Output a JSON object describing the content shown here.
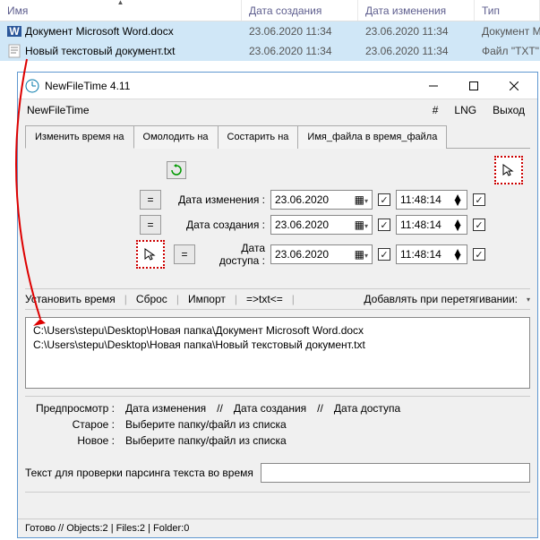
{
  "explorer": {
    "columns": {
      "name": "Имя",
      "created": "Дата создания",
      "modified": "Дата изменения",
      "type": "Тип"
    },
    "rows": [
      {
        "name": "Документ Microsoft Word.docx",
        "created": "23.06.2020 11:34",
        "modified": "23.06.2020 11:34",
        "type": "Документ Micros",
        "icon": "word"
      },
      {
        "name": "Новый текстовый документ.txt",
        "created": "23.06.2020 11:34",
        "modified": "23.06.2020 11:34",
        "type": "Файл \"TXT\"",
        "icon": "txt"
      }
    ]
  },
  "window": {
    "title": "NewFileTime 4.11",
    "brand": "NewFileTime",
    "menu": {
      "hash": "#",
      "lng": "LNG",
      "exit": "Выход"
    }
  },
  "tabs": {
    "set": "Изменить время на",
    "younger": "Омолодить на",
    "older": "Состарить на",
    "filename": "Имя_файла в время_файла"
  },
  "rows": {
    "modified": {
      "label": "Дата изменения :",
      "date": "23.06.2020",
      "time": "11:48:14"
    },
    "created": {
      "label": "Дата создания :",
      "date": "23.06.2020",
      "time": "11:48:14"
    },
    "accessed": {
      "label": "Дата доступа :",
      "date": "23.06.2020",
      "time": "11:48:14"
    },
    "eq": "="
  },
  "actions": {
    "set": "Установить время",
    "reset": "Сброс",
    "import": "Импорт",
    "txt": "=>txt<=",
    "drag": "Добавлять при перетягивании:"
  },
  "files": [
    "C:\\Users\\stepu\\Desktop\\Новая папка\\Документ Microsoft Word.docx",
    "C:\\Users\\stepu\\Desktop\\Новая папка\\Новый текстовый документ.txt"
  ],
  "preview": {
    "label": "Предпросмотр :",
    "modified": "Дата изменения",
    "created": "Дата создания",
    "accessed": "Дата доступа",
    "sep": "//",
    "old_label": "Старое :",
    "new_label": "Новое :",
    "placeholder": "Выберите папку/файл из списка"
  },
  "parse": {
    "label": "Текст для проверки парсинга текста во время",
    "value": ""
  },
  "status": "Готово // Objects:2 | Files:2 | Folder:0"
}
